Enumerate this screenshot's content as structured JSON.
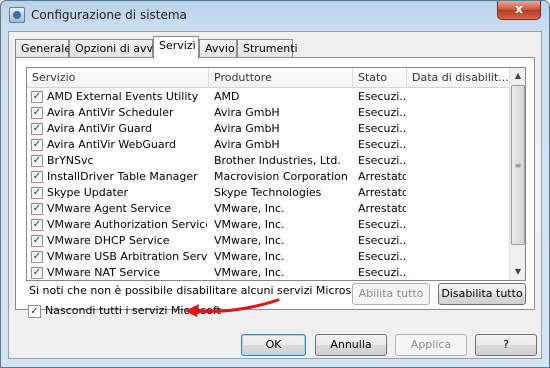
{
  "window": {
    "title": "Configurazione di sistema",
    "close_glyph": "x"
  },
  "tabs": [
    "Generale",
    "Opzioni di avvio",
    "Servizi",
    "Avvio",
    "Strumenti"
  ],
  "active_tab": "Servizi",
  "services": {
    "columns": [
      "Servizio",
      "Produttore",
      "Stato",
      "Data di disabilit..."
    ],
    "rows": [
      {
        "checked": true,
        "name": "AMD External Events Utility",
        "manufacturer": "AMD",
        "status": "Esecuzi..."
      },
      {
        "checked": true,
        "name": "Avira AntiVir Scheduler",
        "manufacturer": "Avira GmbH",
        "status": "Esecuzi..."
      },
      {
        "checked": true,
        "name": "Avira AntiVir Guard",
        "manufacturer": "Avira GmbH",
        "status": "Esecuzi..."
      },
      {
        "checked": true,
        "name": "Avira AntiVir WebGuard",
        "manufacturer": "Avira GmbH",
        "status": "Esecuzi..."
      },
      {
        "checked": true,
        "name": "BrYNSvc",
        "manufacturer": "Brother Industries, Ltd.",
        "status": "Esecuzi..."
      },
      {
        "checked": true,
        "name": "InstallDriver Table Manager",
        "manufacturer": "Macrovision Corporation",
        "status": "Arrestato"
      },
      {
        "checked": true,
        "name": "Skype Updater",
        "manufacturer": "Skype Technologies",
        "status": "Arrestato"
      },
      {
        "checked": true,
        "name": "VMware Agent Service",
        "manufacturer": "VMware, Inc.",
        "status": "Arrestato"
      },
      {
        "checked": true,
        "name": "VMware Authorization Service",
        "manufacturer": "VMware, Inc.",
        "status": "Esecuzi..."
      },
      {
        "checked": true,
        "name": "VMware DHCP Service",
        "manufacturer": "VMware, Inc.",
        "status": "Esecuzi..."
      },
      {
        "checked": true,
        "name": "VMware USB Arbitration Service",
        "manufacturer": "VMware, Inc.",
        "status": "Esecuzi..."
      },
      {
        "checked": true,
        "name": "VMware NAT Service",
        "manufacturer": "VMware, Inc.",
        "status": "Esecuzi..."
      }
    ]
  },
  "note": "Si noti che non è possibile disabilitare alcuni servizi Microsoft sicuri.",
  "buttons": {
    "enable_all": "Abilita tutto",
    "disable_all": "Disabilita tutto",
    "ok": "OK",
    "cancel": "Annulla",
    "apply": "Applica",
    "help": "?"
  },
  "hide_microsoft": {
    "checked": true,
    "label": "Nascondi tutti i servizi Microsoft"
  },
  "icons": {
    "check": "✓",
    "scroll_up": "▲",
    "scroll_down": "▼",
    "thumb_grip": "≡"
  },
  "colors": {
    "annotation_arrow": "#e31414"
  }
}
